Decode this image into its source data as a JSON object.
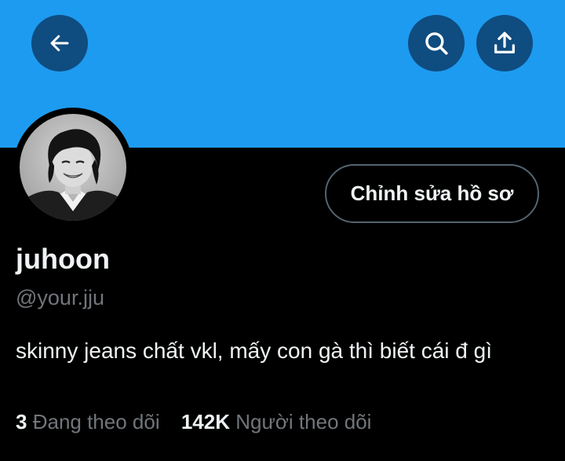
{
  "header": {
    "back_icon": "arrow-left-icon",
    "search_icon": "search-icon",
    "share_icon": "share-upload-icon",
    "banner_color": "#1d9bf0"
  },
  "profile": {
    "display_name": "juhoon",
    "handle": "@your.jju",
    "bio": "skinny jeans chất vkl, mấy con gà thì biết cái đ gì",
    "edit_button_label": "Chỉnh sửa hồ sơ"
  },
  "stats": {
    "following_count": "3",
    "following_label": "Đang theo dõi",
    "followers_count": "142K",
    "followers_label": "Người theo dõi"
  }
}
